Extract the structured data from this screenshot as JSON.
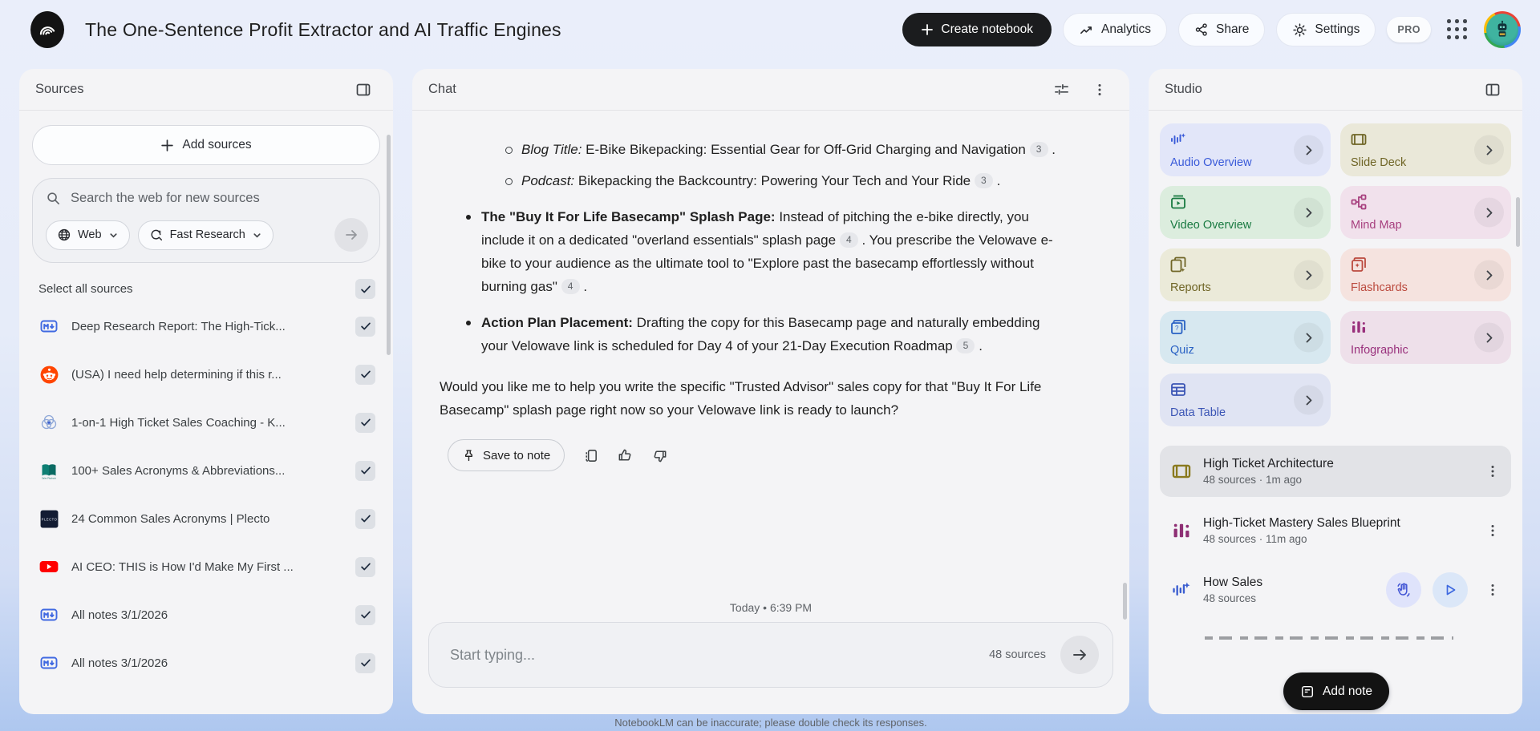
{
  "header": {
    "title": "The One-Sentence Profit Extractor and AI Traffic Engines",
    "create_notebook": "Create notebook",
    "analytics": "Analytics",
    "share": "Share",
    "settings": "Settings",
    "pro_badge": "PRO"
  },
  "sources": {
    "title": "Sources",
    "add_button": "Add sources",
    "search_placeholder": "Search the web for new sources",
    "web_chip": "Web",
    "research_chip": "Fast Research",
    "select_all": "Select all sources",
    "items": [
      {
        "icon": "markdown-icon",
        "title": "Deep Research Report: The High-Tick...",
        "checked": true
      },
      {
        "icon": "reddit-icon",
        "title": "(USA) I need help determining if this r...",
        "checked": true
      },
      {
        "icon": "venn-icon",
        "title": "1-on-1 High Ticket Sales Coaching - K...",
        "checked": true
      },
      {
        "icon": "book-icon",
        "title": "100+ Sales Acronyms & Abbreviations...",
        "checked": true
      },
      {
        "icon": "plecto-icon",
        "title": "24 Common Sales Acronyms | Plecto",
        "checked": true
      },
      {
        "icon": "youtube-icon",
        "title": "AI CEO: THIS is How I'd Make My First ...",
        "checked": true
      },
      {
        "icon": "markdown-icon",
        "title": "All notes 3/1/2026",
        "checked": true
      },
      {
        "icon": "markdown-icon",
        "title": "All notes 3/1/2026",
        "checked": true
      }
    ]
  },
  "chat": {
    "title": "Chat",
    "paragraphs": [
      {
        "type": "sub",
        "segments": [
          {
            "t": "Blog Title:",
            "i": true
          },
          {
            "t": " E-Bike Bikepacking: Essential Gear for Off-Grid Charging and Navigation "
          },
          {
            "chip": "3"
          },
          {
            "t": " ."
          }
        ]
      },
      {
        "type": "sub",
        "segments": [
          {
            "t": "Podcast:",
            "i": true
          },
          {
            "t": " Bikepacking the Backcountry: Powering Your Tech and Your Ride "
          },
          {
            "chip": "3"
          },
          {
            "t": " ."
          }
        ]
      },
      {
        "type": "bullet",
        "segments": [
          {
            "t": "The \"Buy It For Life Basecamp\" Splash Page:",
            "b": true
          },
          {
            "t": " Instead of pitching the e-bike directly, you include it on a dedicated \"overland essentials\" splash page "
          },
          {
            "chip": "4"
          },
          {
            "t": " . You prescribe the Velowave e-bike to your audience as the ultimate tool to \"Explore past the basecamp effortlessly without burning gas\" "
          },
          {
            "chip": "4"
          },
          {
            "t": " ."
          }
        ]
      },
      {
        "type": "bullet",
        "segments": [
          {
            "t": "Action Plan Placement:",
            "b": true
          },
          {
            "t": " Drafting the copy for this Basecamp page and naturally embedding your Velowave link is scheduled for Day 4 of your 21-Day Execution Roadmap "
          },
          {
            "chip": "5"
          },
          {
            "t": " ."
          }
        ]
      },
      {
        "type": "plain",
        "segments": [
          {
            "t": "Would you like me to help you write the specific \"Trusted Advisor\" sales copy for that \"Buy It For Life Basecamp\" splash page right now so your Velowave link is ready to launch?"
          }
        ]
      }
    ],
    "save_to_note": "Save to note",
    "timestamp": "Today • 6:39 PM",
    "input_placeholder": "Start typing...",
    "sources_count": "48 sources",
    "disclaimer": "NotebookLM can be inaccurate; please double check its responses."
  },
  "studio": {
    "title": "Studio",
    "tiles": [
      {
        "icon": "audio-overview-icon",
        "label": "Audio Overview",
        "bg": "#e2e6f9",
        "fg": "#3a5bd9"
      },
      {
        "icon": "slide-deck-icon",
        "label": "Slide Deck",
        "bg": "#eae8d9",
        "fg": "#6f6526"
      },
      {
        "icon": "video-overview-icon",
        "label": "Video Overview",
        "bg": "#dcedde",
        "fg": "#197a41"
      },
      {
        "icon": "mind-map-icon",
        "label": "Mind Map",
        "bg": "#f1e1ec",
        "fg": "#a73f7e"
      },
      {
        "icon": "reports-icon",
        "label": "Reports",
        "bg": "#ebead9",
        "fg": "#6f6526"
      },
      {
        "icon": "flashcards-icon",
        "label": "Flashcards",
        "bg": "#f5e3df",
        "fg": "#bb4a3e"
      },
      {
        "icon": "quiz-icon",
        "label": "Quiz",
        "bg": "#d7e8f0",
        "fg": "#2a62c4"
      },
      {
        "icon": "infographic-icon",
        "label": "Infographic",
        "bg": "#eee0ea",
        "fg": "#99307c"
      },
      {
        "icon": "data-table-icon",
        "label": "Data Table",
        "bg": "#e0e4f3",
        "fg": "#3b55b5"
      }
    ],
    "items": [
      {
        "icon": "slide-deck-olive-icon",
        "title": "High Ticket Architecture",
        "meta": "48 sources · 1m ago",
        "selected": true,
        "media": false
      },
      {
        "icon": "infographic-purple-icon",
        "title": "High-Ticket Mastery Sales Blueprint",
        "meta": "48 sources · 11m ago",
        "selected": false,
        "media": false
      },
      {
        "icon": "audio-waveform-icon",
        "title": "How Sales",
        "meta": "48 sources",
        "selected": false,
        "media": true
      }
    ],
    "add_note": "Add note"
  }
}
